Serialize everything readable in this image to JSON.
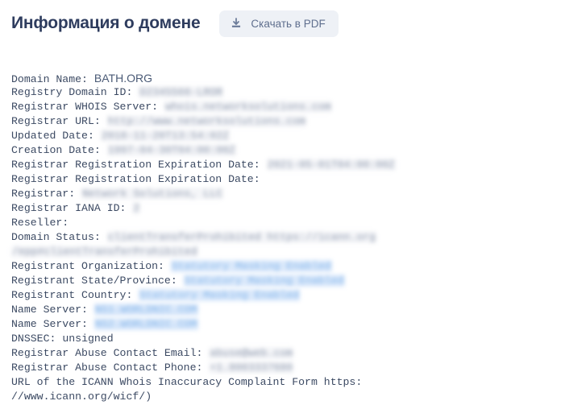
{
  "header": {
    "title": "Информация о домене",
    "download_button": {
      "label": "Скачать в PDF",
      "icon": "download-icon"
    }
  },
  "colors": {
    "title": "#2e3c5e",
    "button_bg": "#eef1f6",
    "button_text": "#5f6f8e",
    "text": "#3c4a63",
    "redacted_blue_bg": "#dbe9fb",
    "redacted_gray_bg": "#f4f5f8",
    "page_bg": "#ffffff"
  },
  "whois": {
    "lines": [
      {
        "label": "Domain Name:",
        "value": "BATH.ORG",
        "style": "sans"
      },
      {
        "label": "Registry Domain ID:",
        "value": "D2345566-LROR",
        "style": "gray"
      },
      {
        "label": "Registrar WHOIS Server:",
        "value": "whois.networksolutions.com",
        "style": "gray"
      },
      {
        "label": "Registrar URL:",
        "value": "http://www.networksolutions.com",
        "style": "gray"
      },
      {
        "label": "Updated Date:",
        "value": "2018-11-20T13:54:02Z",
        "style": "gray"
      },
      {
        "label": "Creation Date:",
        "value": "1997-04-30T04:00:00Z",
        "style": "gray"
      },
      {
        "label": "Registrar Registration Expiration Date:",
        "value": "2021-05-01T04:00:00Z",
        "style": "gray"
      },
      {
        "label": "Registrar Registration Expiration Date:",
        "value": "",
        "style": "none"
      },
      {
        "label": "Registrar:",
        "value": "Network Solutions, LLC",
        "style": "gray"
      },
      {
        "label": "Registrar IANA ID:",
        "value": "2",
        "style": "gray"
      },
      {
        "label": "Reseller:",
        "value": "",
        "style": "none"
      },
      {
        "label": "Domain Status:",
        "value": "clientTransferProhibited https://icann.org",
        "style": "gray"
      },
      {
        "label": "",
        "value": "/epp#clientTransferProhibited",
        "style": "gray",
        "continuation": true
      },
      {
        "label": "Registrant Organization:",
        "value": "Statutory Masking Enabled",
        "style": "blue"
      },
      {
        "label": "Registrant State/Province:",
        "value": "Statutory Masking Enabled",
        "style": "blue"
      },
      {
        "label": "Registrant Country:",
        "value": "Statutory Masking Enabled",
        "style": "blue"
      },
      {
        "label": "Name Server:",
        "value": "NS1.WORLDNIC.COM",
        "style": "blue"
      },
      {
        "label": "Name Server:",
        "value": "NS2.WORLDNIC.COM",
        "style": "blue"
      },
      {
        "label": "DNSSEC:",
        "value": "unsigned",
        "style": "plain"
      },
      {
        "label": "Registrar Abuse Contact Email:",
        "value": "abuse@web.com",
        "style": "gray"
      },
      {
        "label": "Registrar Abuse Contact Phone:",
        "value": "+1.8003337680",
        "style": "gray"
      },
      {
        "label": "URL of the ICANN Whois Inaccuracy Complaint Form https:",
        "value": "",
        "style": "none"
      },
      {
        "label": "//www.icann.org/wicf/)",
        "value": "",
        "style": "none"
      }
    ]
  }
}
